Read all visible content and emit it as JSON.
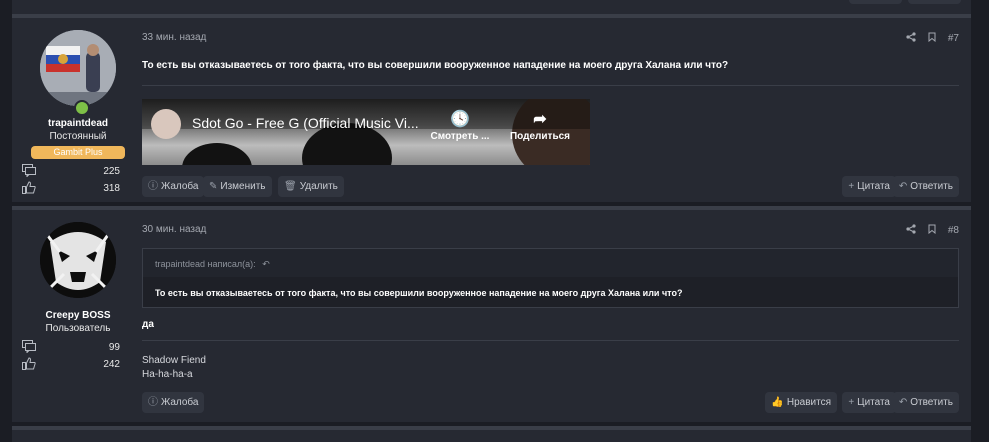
{
  "posts": [
    {
      "time": "33 мин. назад",
      "number": "#7",
      "user": {
        "name": "trapaintdead",
        "title": "Постоянный",
        "badge": "Gambit Plus",
        "messages": "225",
        "reactions": "318",
        "online": true
      },
      "message": "То есть вы отказываетесь от того факта, что вы совершили вооруженное нападение на моего друга Халана или что?",
      "video": {
        "title": "Sdot Go - Free G (Official Music Vi...",
        "watch_label": "Смотреть ...",
        "share_label": "Поделиться"
      },
      "actions_left": [
        "Жалоба",
        "Изменить",
        "Удалить"
      ],
      "actions_right": [
        "Цитата",
        "Ответить"
      ]
    },
    {
      "time": "30 мин. назад",
      "number": "#8",
      "user": {
        "name": "Creepy BOSS",
        "title": "Пользователь",
        "messages": "99",
        "reactions": "242"
      },
      "quote": {
        "author_line": "trapaintdead написал(а):",
        "text": "То есть вы отказываетесь от того факта, что вы совершили вооруженное нападение на моего друга Халана или что?"
      },
      "message": "да",
      "signature": [
        "Shadow Fiend",
        "Ha-ha-ha-a"
      ],
      "actions_left": [
        "Жалоба"
      ],
      "actions_right": [
        "Нравится",
        "Цитата",
        "Ответить"
      ]
    }
  ],
  "colors": {
    "page_bg": "#1b1d24",
    "post_bg": "#262932",
    "border": "#3a3e48",
    "badge": "#f0b75b",
    "online": "#7ec047"
  }
}
